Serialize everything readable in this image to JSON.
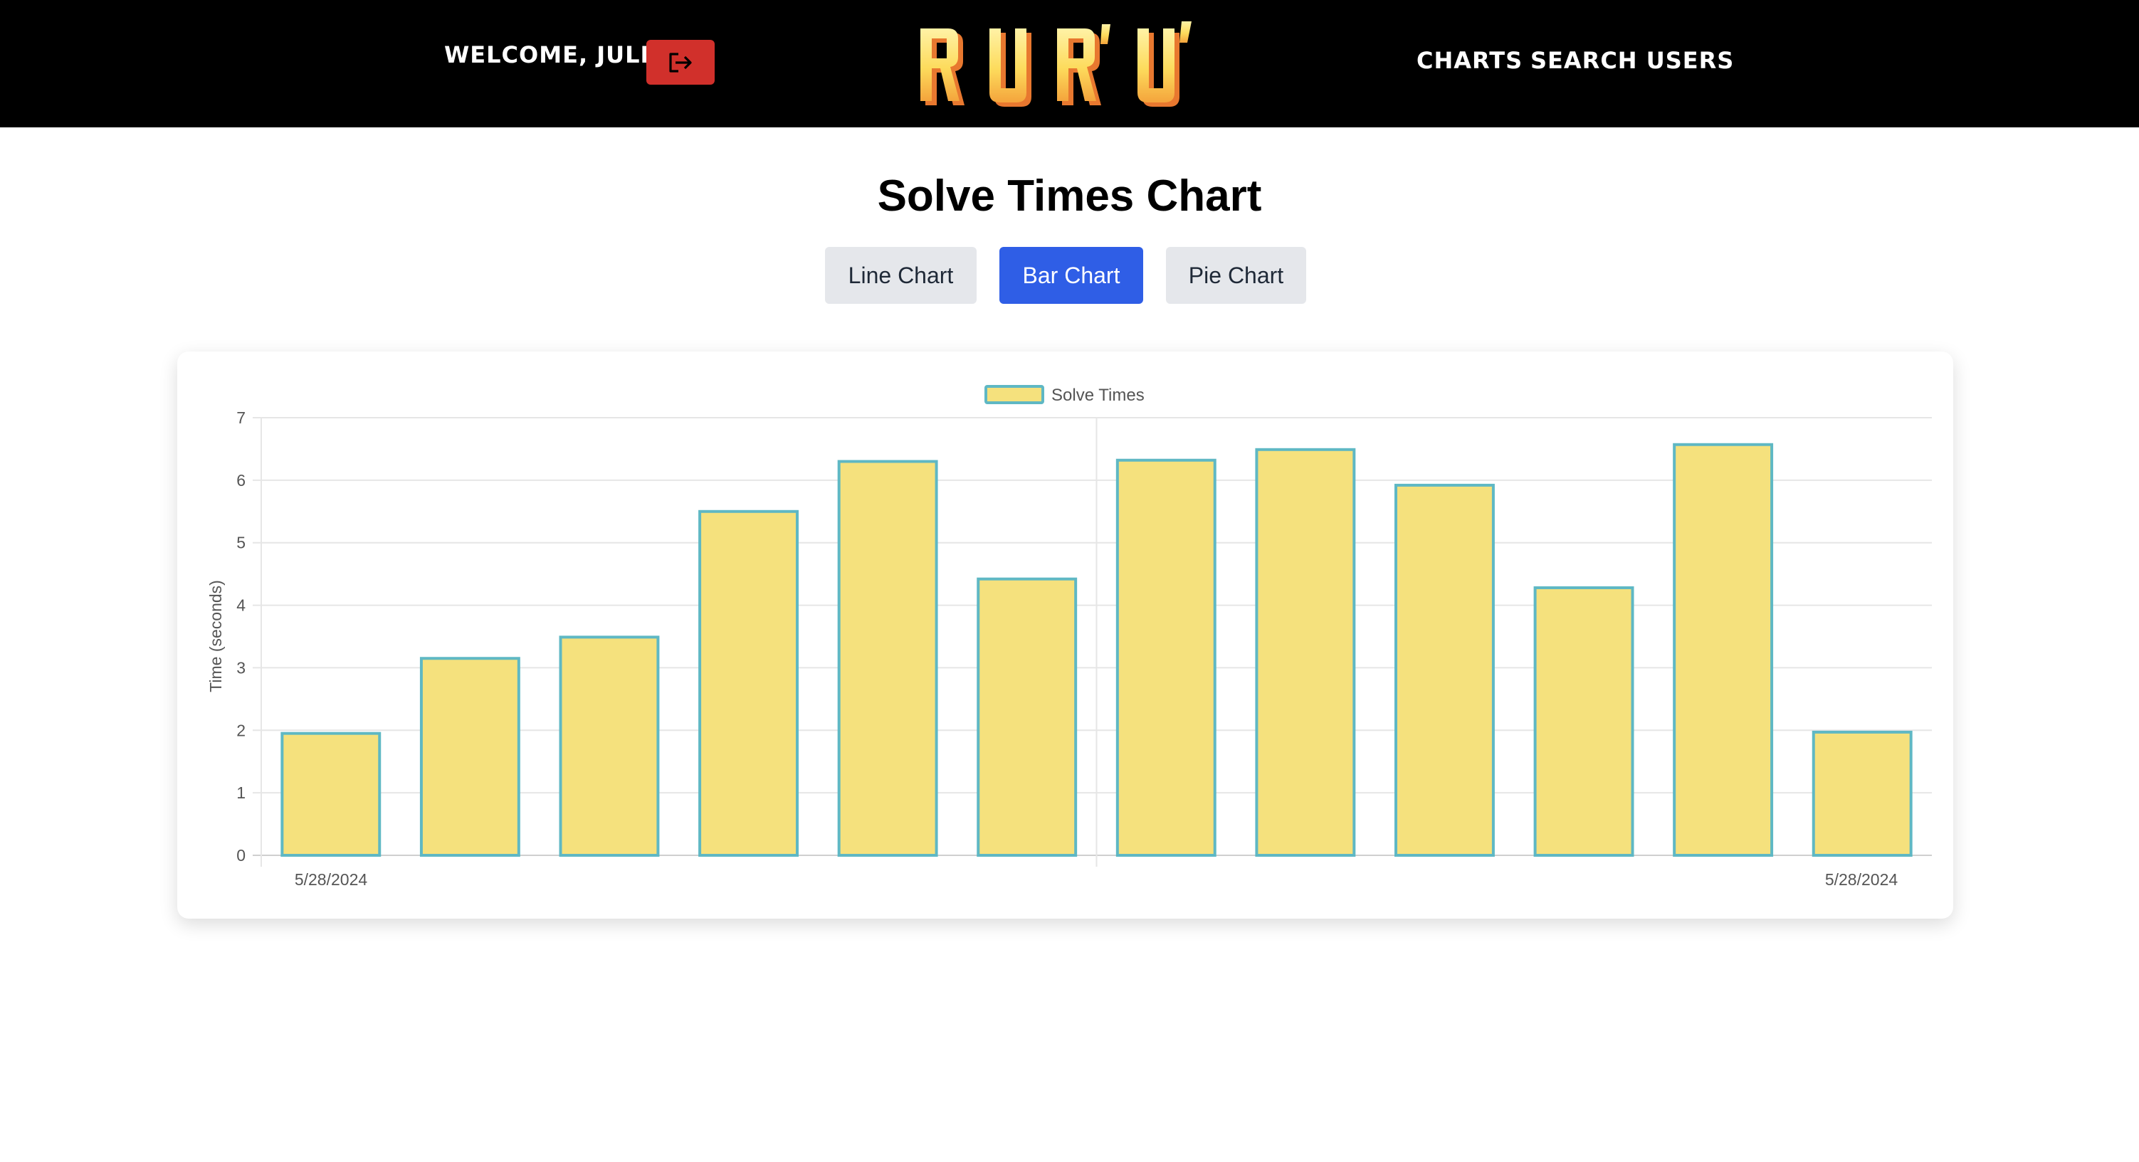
{
  "header": {
    "welcome_text": "WELCOME, JULI",
    "logo_text": "R U R' U'",
    "nav": [
      {
        "label": "CHARTS"
      },
      {
        "label": "SEARCH USERS"
      }
    ],
    "logout_icon": "logout-icon"
  },
  "page": {
    "title": "Solve Times Chart"
  },
  "chart_tabs": [
    {
      "label": "Line Chart",
      "active": false
    },
    {
      "label": "Bar Chart",
      "active": true
    },
    {
      "label": "Pie Chart",
      "active": false
    }
  ],
  "colors": {
    "header_bg": "#000000",
    "logout_bg": "#d1302b",
    "active_tab": "#2f5ee6",
    "inactive_tab": "#e5e7eb",
    "bar_fill": "#f5e17d",
    "bar_border": "#5fb8c4",
    "logo_light": "#fde36a",
    "logo_dark": "#f0893c"
  },
  "chart_data": {
    "type": "bar",
    "legend": "Solve Times",
    "legend_position": "top-center",
    "ylabel": "Time (seconds)",
    "xlabel": "",
    "ylim": [
      0,
      7
    ],
    "yticks": [
      0,
      1,
      2,
      3,
      4,
      5,
      6,
      7
    ],
    "grid": true,
    "x_tick_labels": [
      "5/28/2024",
      "5/28/2024"
    ],
    "series": [
      {
        "name": "Solve Times",
        "values": [
          1.95,
          3.15,
          3.49,
          5.5,
          6.3,
          4.42,
          6.32,
          6.49,
          5.92,
          4.28,
          6.57,
          1.97
        ]
      }
    ]
  }
}
